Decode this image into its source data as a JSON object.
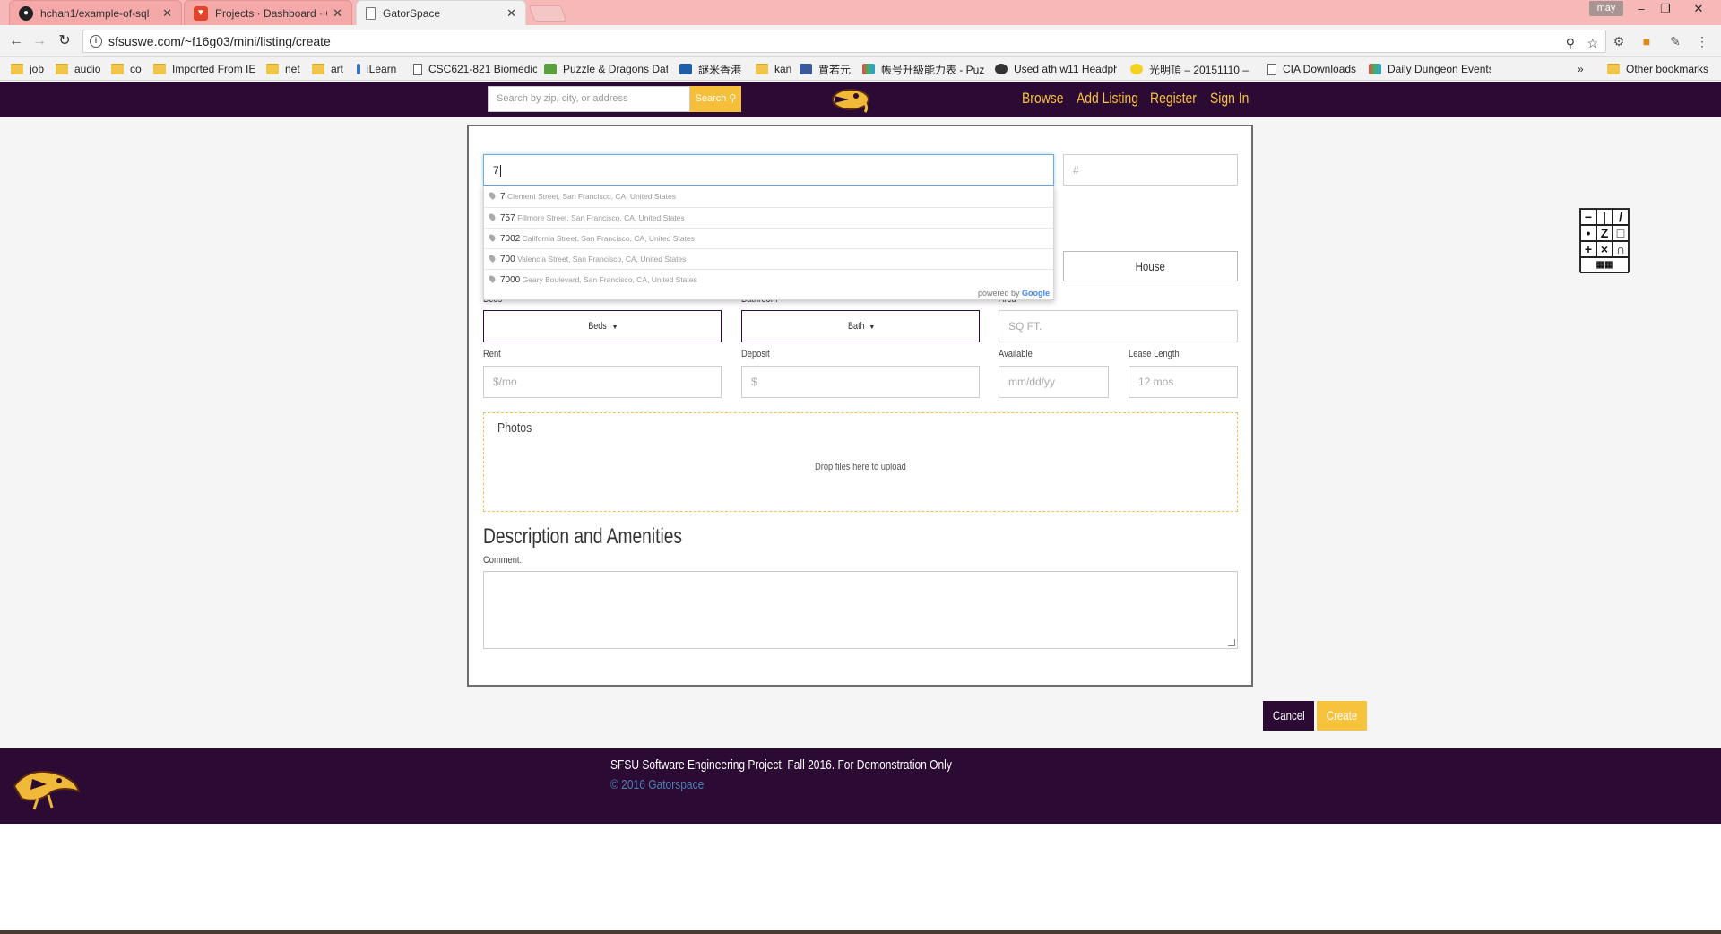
{
  "browser": {
    "tabs": [
      {
        "title": "hchan1/example-of-sql",
        "icon": "github-icon",
        "color": "#222222"
      },
      {
        "title": "Projects · Dashboard · Gi",
        "icon": "gitlab-icon",
        "color": "#e24329"
      },
      {
        "title": "GatorSpace",
        "icon": "page-icon",
        "color": "#ffffff"
      }
    ],
    "profile": "may",
    "url": "sfsuswe.com/~f16g03/mini/listing/create",
    "bookmarks": [
      {
        "label": "job",
        "icon": "folder-icon"
      },
      {
        "label": "audio",
        "icon": "folder-icon"
      },
      {
        "label": "co",
        "icon": "folder-icon"
      },
      {
        "label": "Imported From IE",
        "icon": "folder-icon"
      },
      {
        "label": "net",
        "icon": "folder-icon"
      },
      {
        "label": "art",
        "icon": "folder-icon"
      },
      {
        "label": "iLearn",
        "icon": "ilearn-icon"
      },
      {
        "label": "CSC621-821 Biomedic",
        "icon": "page-icon"
      },
      {
        "label": "Puzzle & Dragons Dat",
        "icon": "puzzle-dragons-icon"
      },
      {
        "label": "謎米香港",
        "icon": "m-icon"
      },
      {
        "label": "kan",
        "icon": "folder-icon"
      },
      {
        "label": "賈若元",
        "icon": "facebook-icon"
      },
      {
        "label": "帳号升級能力表 - Puz",
        "icon": "pinwheel-icon"
      },
      {
        "label": "Used ath w11 Headph",
        "icon": "ath-icon"
      },
      {
        "label": "光明頂 – 20151110 –",
        "icon": "smiley-icon"
      },
      {
        "label": "CIA Downloads",
        "icon": "page-icon"
      },
      {
        "label": "Daily Dungeon Events",
        "icon": "pinwheel-icon"
      }
    ],
    "overflow": "»",
    "other_bookmarks": "Other bookmarks"
  },
  "site_nav": {
    "search_placeholder": "Search by zip, city, or address",
    "search_button": "Search",
    "links": [
      "Browse",
      "Add Listing",
      "Register",
      "Sign In"
    ]
  },
  "form": {
    "address_value": "7",
    "unit_placeholder": "#",
    "autocomplete": [
      {
        "main": "7",
        "rest": "Clement Street, San Francisco, CA, United States"
      },
      {
        "main": "757",
        "rest": "Fillmore Street, San Francisco, CA, United States"
      },
      {
        "main": "7002",
        "rest": "California Street, San Francisco, CA, United States"
      },
      {
        "main": "700",
        "rest": "Valencia Street, San Francisco, CA, United States"
      },
      {
        "main": "7000",
        "rest": "Geary Boulevard, San Francisco, CA, United States"
      }
    ],
    "powered_by": "powered by",
    "powered_brand": "Google",
    "house_button": "House",
    "labels": {
      "beds": "Beds",
      "bathroom": "Bathroom",
      "area": "Area",
      "rent": "Rent",
      "deposit": "Deposit",
      "available": "Available",
      "lease_length": "Lease Length",
      "comment": "Comment:"
    },
    "beds_dropdown": "Beds",
    "bath_dropdown": "Bath",
    "area_placeholder": "SQ FT.",
    "rent_placeholder": "$/mo",
    "deposit_placeholder": "$",
    "available_placeholder": "mm/dd/yy",
    "lease_placeholder": "12 mos",
    "photos_title": "Photos",
    "drop_text": "Drop files here to upload",
    "section_title": "Description and Amenities",
    "cancel": "Cancel",
    "create": "Create"
  },
  "footer": {
    "line1": "SFSU Software Engineering Project, Fall 2016. For Demonstration Only",
    "line2": "© 2016 Gatorspace"
  },
  "colors": {
    "brand_purple": "#2b0a33",
    "brand_gold": "#f7c23c",
    "tabbar": "#f7b8b8"
  }
}
